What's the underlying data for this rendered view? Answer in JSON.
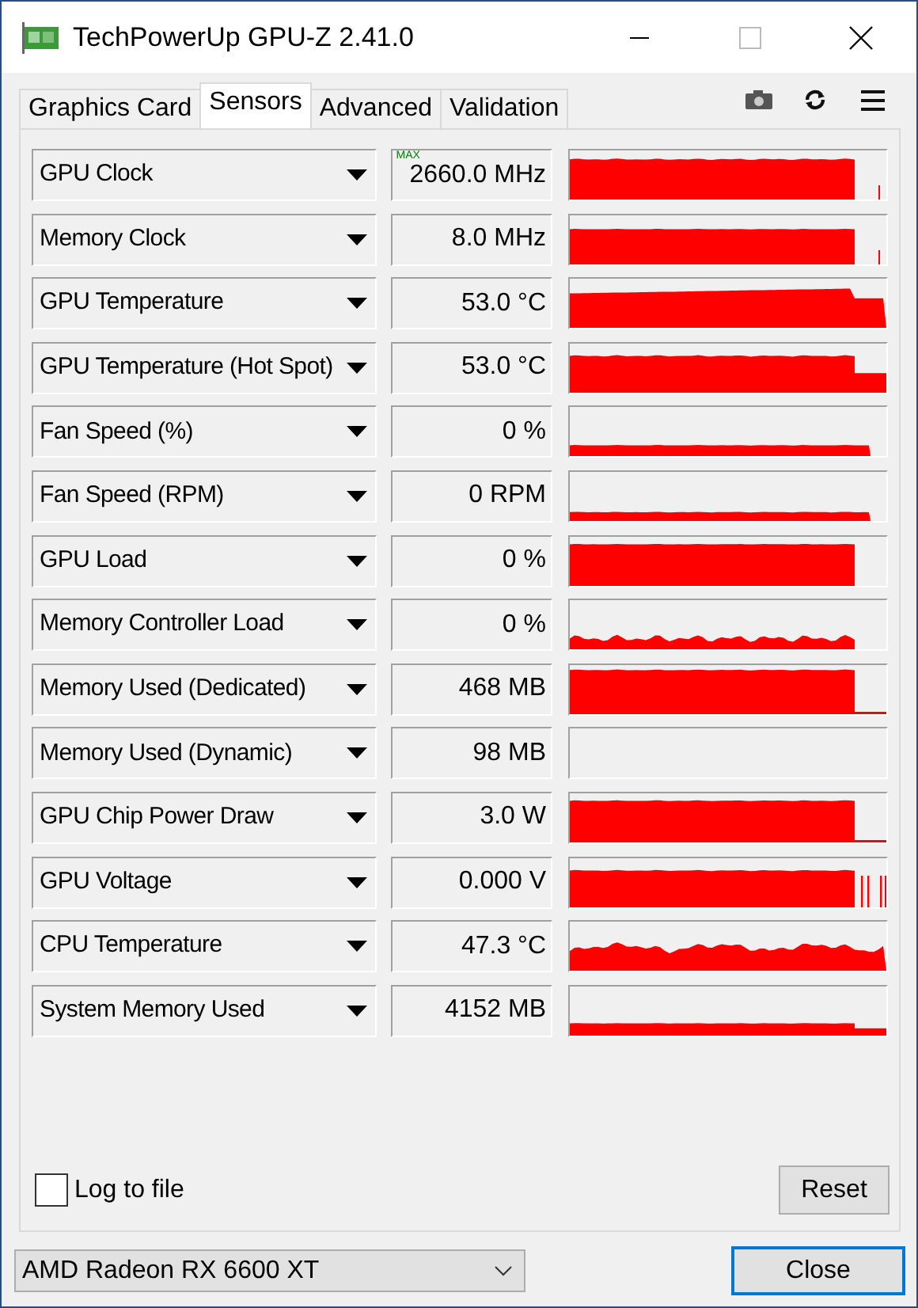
{
  "window": {
    "title": "TechPowerUp GPU-Z 2.41.0"
  },
  "tabs": [
    {
      "label": "Graphics Card",
      "selected": false
    },
    {
      "label": "Sensors",
      "selected": true
    },
    {
      "label": "Advanced",
      "selected": false
    },
    {
      "label": "Validation",
      "selected": false
    }
  ],
  "sensors": [
    {
      "name": "GPU Clock",
      "value": "2660.0 MHz",
      "mode_label": "MAX"
    },
    {
      "name": "Memory Clock",
      "value": "8.0 MHz"
    },
    {
      "name": "GPU Temperature",
      "value": "53.0 °C"
    },
    {
      "name": "GPU Temperature (Hot Spot)",
      "value": "53.0 °C"
    },
    {
      "name": "Fan Speed (%)",
      "value": "0 %"
    },
    {
      "name": "Fan Speed (RPM)",
      "value": "0 RPM"
    },
    {
      "name": "GPU Load",
      "value": "0 %"
    },
    {
      "name": "Memory Controller Load",
      "value": "0 %"
    },
    {
      "name": "Memory Used (Dedicated)",
      "value": "468 MB"
    },
    {
      "name": "Memory Used (Dynamic)",
      "value": "98 MB"
    },
    {
      "name": "GPU Chip Power Draw",
      "value": "3.0 W"
    },
    {
      "name": "GPU Voltage",
      "value": "0.000 V"
    },
    {
      "name": "CPU Temperature",
      "value": "47.3 °C"
    },
    {
      "name": "System Memory Used",
      "value": "4152 MB"
    }
  ],
  "log_to_file": {
    "label": "Log to file",
    "checked": false
  },
  "reset_button": "Reset",
  "gpu_select": {
    "value": "AMD Radeon RX 6600 XT"
  },
  "close_button": "Close"
}
